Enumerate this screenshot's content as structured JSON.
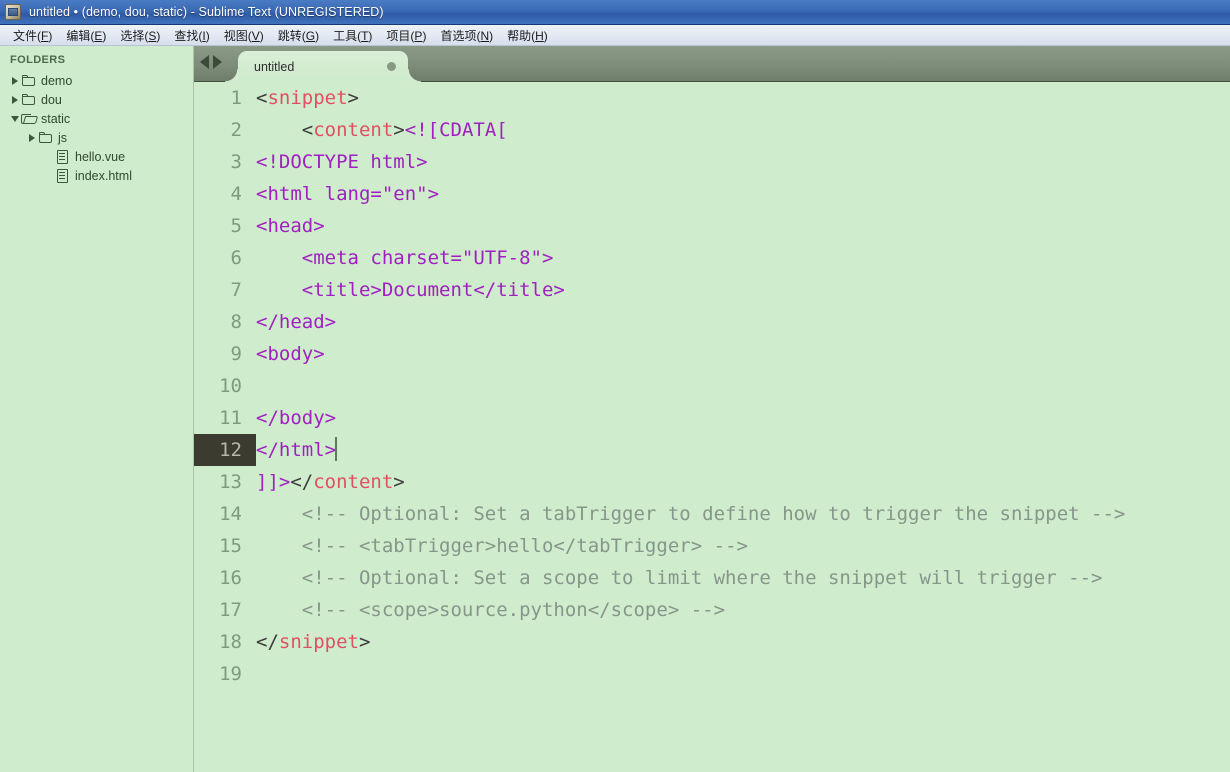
{
  "window": {
    "title": "untitled • (demo, dou, static) - Sublime Text (UNREGISTERED)",
    "icon": "sublime-app-icon"
  },
  "menubar": {
    "items": [
      {
        "label": "文件(F)",
        "text": "文件(",
        "accel": "F",
        "tail": ")"
      },
      {
        "label": "编辑(E)",
        "text": "编辑(",
        "accel": "E",
        "tail": ")"
      },
      {
        "label": "选择(S)",
        "text": "选择(",
        "accel": "S",
        "tail": ")"
      },
      {
        "label": "查找(I)",
        "text": "查找(",
        "accel": "I",
        "tail": ")"
      },
      {
        "label": "视图(V)",
        "text": "视图(",
        "accel": "V",
        "tail": ")"
      },
      {
        "label": "跳转(G)",
        "text": "跳转(",
        "accel": "G",
        "tail": ")"
      },
      {
        "label": "工具(T)",
        "text": "工具(",
        "accel": "T",
        "tail": ")"
      },
      {
        "label": "项目(P)",
        "text": "项目(",
        "accel": "P",
        "tail": ")"
      },
      {
        "label": "首选项(N)",
        "text": "首选项(",
        "accel": "N",
        "tail": ")"
      },
      {
        "label": "帮助(H)",
        "text": "帮助(",
        "accel": "H",
        "tail": ")"
      }
    ]
  },
  "sidebar": {
    "header": "FOLDERS",
    "tree": [
      {
        "label": "demo",
        "type": "folder",
        "state": "closed",
        "indent": 0
      },
      {
        "label": "dou",
        "type": "folder",
        "state": "closed",
        "indent": 0
      },
      {
        "label": "static",
        "type": "folder-open",
        "state": "open",
        "indent": 0
      },
      {
        "label": "js",
        "type": "folder",
        "state": "closed",
        "indent": 1
      },
      {
        "label": "hello.vue",
        "type": "file",
        "state": "none",
        "indent": 2
      },
      {
        "label": "index.html",
        "type": "file",
        "state": "none",
        "indent": 2
      }
    ]
  },
  "tabbar": {
    "nav_prev": "previous-tab",
    "nav_next": "next-tab",
    "tabs": [
      {
        "label": "untitled",
        "dirty": true,
        "active": true
      }
    ]
  },
  "editor": {
    "cursor_line": 12,
    "colors": {
      "background": "#cfeccd",
      "tag_name": "#e34f62",
      "plain_text": "#a020c0",
      "bracket": "#3b3b3b",
      "comment": "#86968a",
      "gutter_number": "#7f9b7d",
      "active_gutter_bg": "#3b3b30"
    },
    "lines": [
      {
        "n": "1",
        "active": false,
        "tokens": [
          {
            "t": "br",
            "v": "<"
          },
          {
            "t": "tag",
            "v": "snippet"
          },
          {
            "t": "br",
            "v": ">"
          }
        ]
      },
      {
        "n": "2",
        "active": false,
        "tokens": [
          {
            "t": "br",
            "v": "    <"
          },
          {
            "t": "tag",
            "v": "content"
          },
          {
            "t": "br",
            "v": ">"
          },
          {
            "t": "plain",
            "v": "<![CDATA["
          }
        ]
      },
      {
        "n": "3",
        "active": false,
        "tokens": [
          {
            "t": "plain",
            "v": "<!DOCTYPE html>"
          }
        ]
      },
      {
        "n": "4",
        "active": false,
        "tokens": [
          {
            "t": "plain",
            "v": "<html lang=\"en\">"
          }
        ]
      },
      {
        "n": "5",
        "active": false,
        "tokens": [
          {
            "t": "plain",
            "v": "<head>"
          }
        ]
      },
      {
        "n": "6",
        "active": false,
        "tokens": [
          {
            "t": "plain",
            "v": "    <meta charset=\"UTF-8\">"
          }
        ]
      },
      {
        "n": "7",
        "active": false,
        "tokens": [
          {
            "t": "plain",
            "v": "    <title>Document</title>"
          }
        ]
      },
      {
        "n": "8",
        "active": false,
        "tokens": [
          {
            "t": "plain",
            "v": "</head>"
          }
        ]
      },
      {
        "n": "9",
        "active": false,
        "tokens": [
          {
            "t": "plain",
            "v": "<body>"
          }
        ]
      },
      {
        "n": "10",
        "active": false,
        "tokens": [
          {
            "t": "plain",
            "v": ""
          }
        ]
      },
      {
        "n": "11",
        "active": false,
        "tokens": [
          {
            "t": "plain",
            "v": "</body>"
          }
        ]
      },
      {
        "n": "12",
        "active": true,
        "tokens": [
          {
            "t": "plain",
            "v": "</html>"
          },
          {
            "t": "caret",
            "v": ""
          }
        ]
      },
      {
        "n": "13",
        "active": false,
        "tokens": [
          {
            "t": "plain",
            "v": "]]>"
          },
          {
            "t": "br",
            "v": "</"
          },
          {
            "t": "tag",
            "v": "content"
          },
          {
            "t": "br",
            "v": ">"
          }
        ]
      },
      {
        "n": "14",
        "active": false,
        "tokens": [
          {
            "t": "cmt",
            "v": "    <!-- Optional: Set a tabTrigger to define how to trigger the snippet -->"
          }
        ]
      },
      {
        "n": "15",
        "active": false,
        "tokens": [
          {
            "t": "cmt",
            "v": "    <!-- <tabTrigger>hello</tabTrigger> -->"
          }
        ]
      },
      {
        "n": "16",
        "active": false,
        "tokens": [
          {
            "t": "cmt",
            "v": "    <!-- Optional: Set a scope to limit where the snippet will trigger -->"
          }
        ]
      },
      {
        "n": "17",
        "active": false,
        "tokens": [
          {
            "t": "cmt",
            "v": "    <!-- <scope>source.python</scope> -->"
          }
        ]
      },
      {
        "n": "18",
        "active": false,
        "tokens": [
          {
            "t": "br",
            "v": "</"
          },
          {
            "t": "tag",
            "v": "snippet"
          },
          {
            "t": "br",
            "v": ">"
          }
        ]
      },
      {
        "n": "19",
        "active": false,
        "tokens": [
          {
            "t": "plain",
            "v": ""
          }
        ]
      }
    ]
  }
}
